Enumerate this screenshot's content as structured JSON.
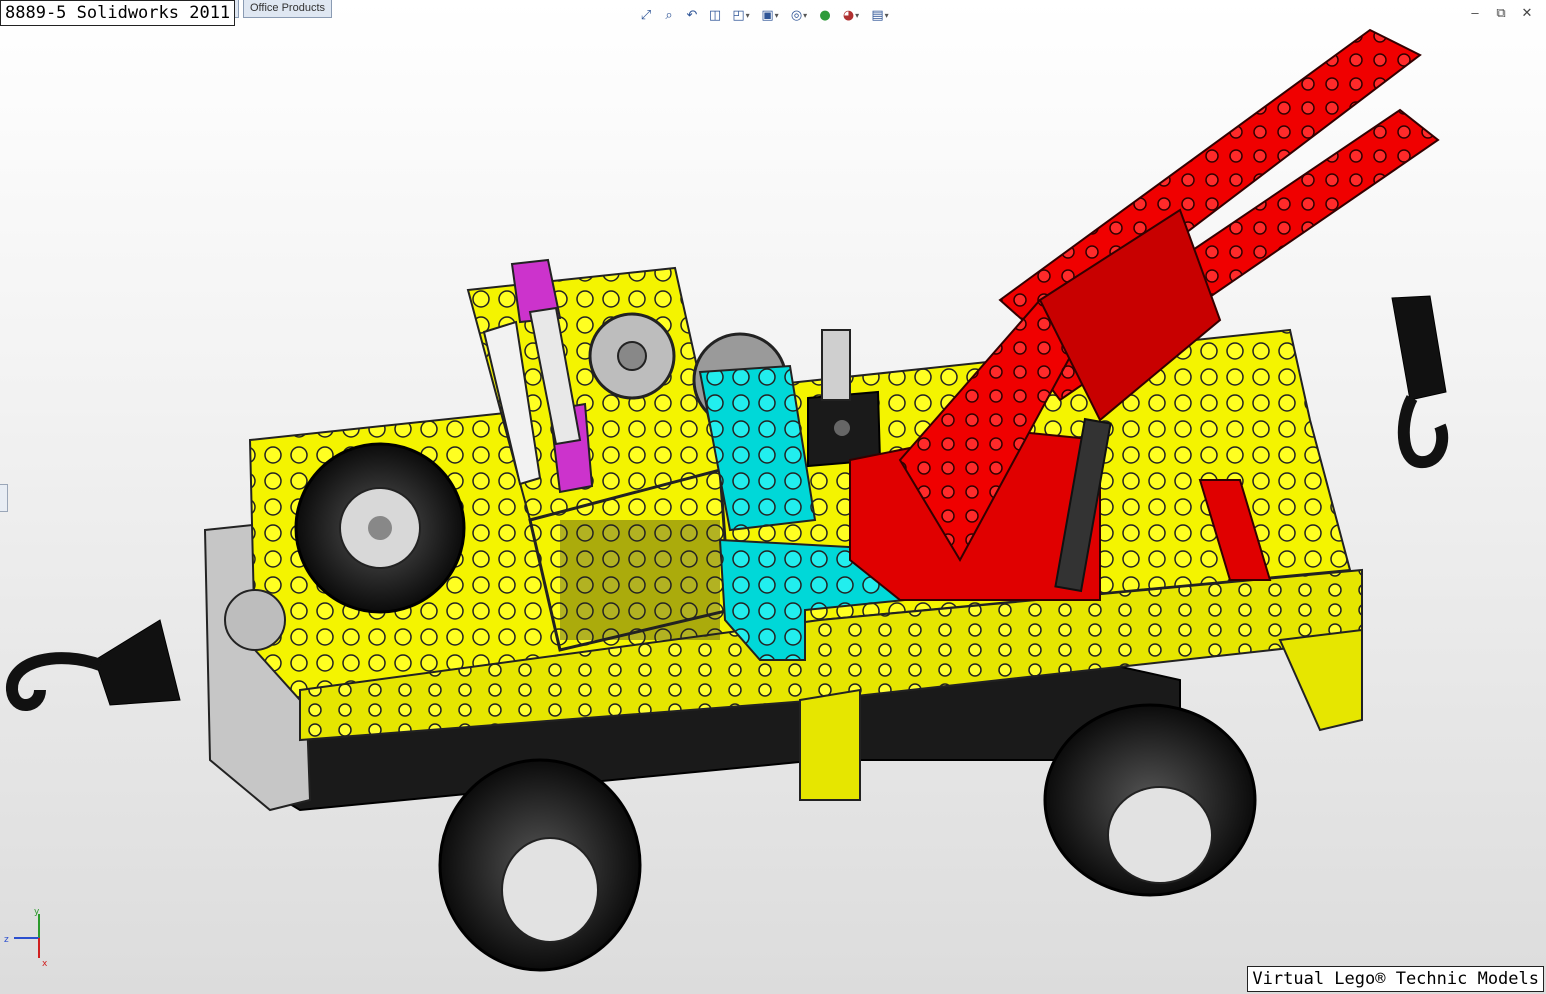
{
  "document": {
    "title": "8889-5 Solidworks 2011"
  },
  "tabs": {
    "partial_label": "e",
    "office_label": "Office Products"
  },
  "toolbar": [
    {
      "icon": "zoom-to-fit-icon",
      "glyph": "⤢"
    },
    {
      "icon": "zoom-to-area-icon",
      "glyph": "⌕"
    },
    {
      "icon": "previous-view-icon",
      "glyph": "↶"
    },
    {
      "icon": "section-view-icon",
      "glyph": "◫"
    },
    {
      "icon": "view-orientation-icon",
      "glyph": "◰"
    },
    {
      "icon": "display-style-icon",
      "glyph": "▣"
    },
    {
      "icon": "hide-show-items-icon",
      "glyph": "◎"
    },
    {
      "icon": "edit-appearance-icon",
      "glyph": "●"
    },
    {
      "icon": "apply-scene-icon",
      "glyph": "◕"
    },
    {
      "icon": "view-settings-icon",
      "glyph": "▤"
    }
  ],
  "window": {
    "minimize": "–",
    "restore": "⧉",
    "close": "✕"
  },
  "watermark": "Virtual Lego® Technic Models",
  "axes": {
    "x": "x",
    "y": "y",
    "z": "z"
  },
  "colors": {
    "yellow": "#ffff00",
    "red": "#ff0000",
    "cyan": "#00e0e0",
    "magenta": "#cc33cc",
    "black": "#111111",
    "gray": "#bdbdbd"
  }
}
